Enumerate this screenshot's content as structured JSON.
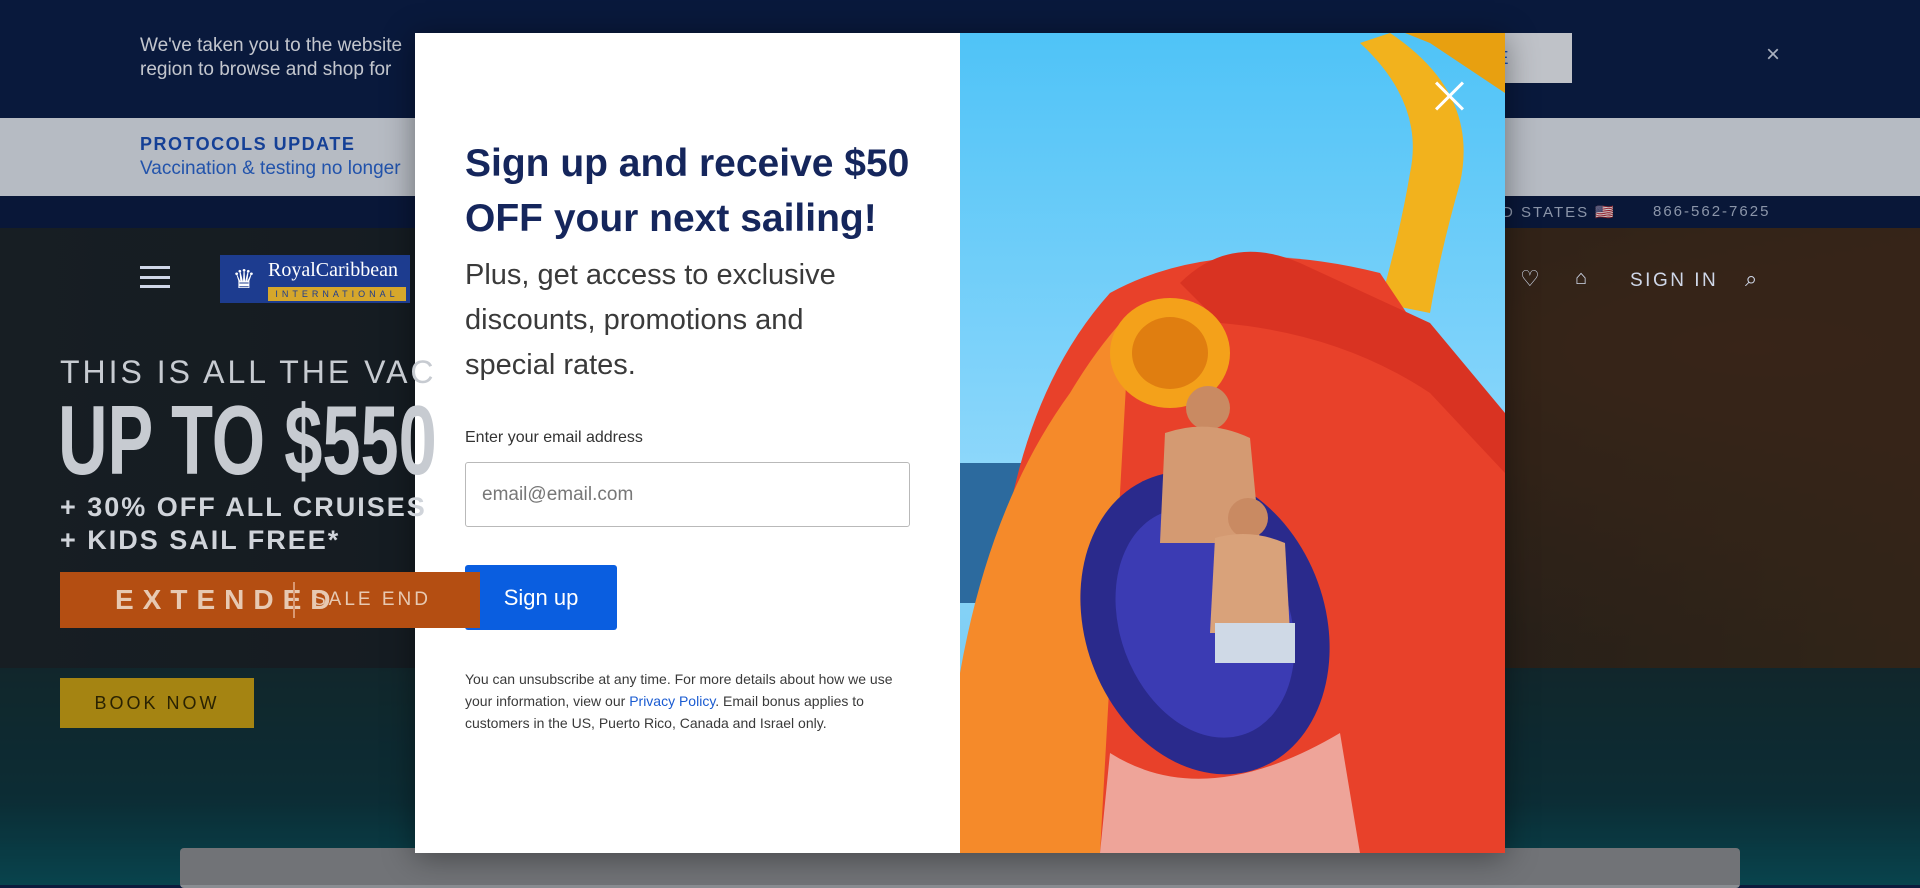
{
  "region_banner": {
    "message": "We've taken you to the website region to browse and shop for",
    "continue_label": "UE",
    "close_glyph": "×"
  },
  "protocols": {
    "title": "PROTOCOLS UPDATE",
    "text": "Vaccination & testing no longer"
  },
  "utility_bar": {
    "country": "ED STATES 🇺🇸",
    "phone": "866-562-7625"
  },
  "nav": {
    "brand_name": "RoyalCaribbean",
    "brand_sub": "INTERNATIONAL",
    "sign_in": "SIGN IN"
  },
  "hero": {
    "eyebrow": "THIS IS ALL THE VAC",
    "big": "UP TO $550",
    "line1": "+ 30% OFF ALL CRUISES",
    "line2": "+ KIDS SAIL FREE*",
    "extended": "EXTENDED",
    "sale_end": "SALE END",
    "book_now": "BOOK NOW"
  },
  "modal": {
    "heading": "Sign up and receive $50 OFF your next sailing!",
    "subtext": "Plus, get access to exclusive discounts, promotions and special rates.",
    "email_label": "Enter your email address",
    "email_placeholder": "email@email.com",
    "email_value": "",
    "signup_label": "Sign up",
    "legal_before": "You can unsubscribe at any time. For more details about how we use your information, view our ",
    "privacy_link": "Privacy Policy",
    "legal_after": ". Email bonus applies to customers in the US, Puerto Rico, Canada and Israel only."
  },
  "colors": {
    "brand_navy": "#15265c",
    "signup_blue": "#0a5ee0",
    "link_blue": "#1a5bd1",
    "banner_navy": "#0b1f4a"
  }
}
